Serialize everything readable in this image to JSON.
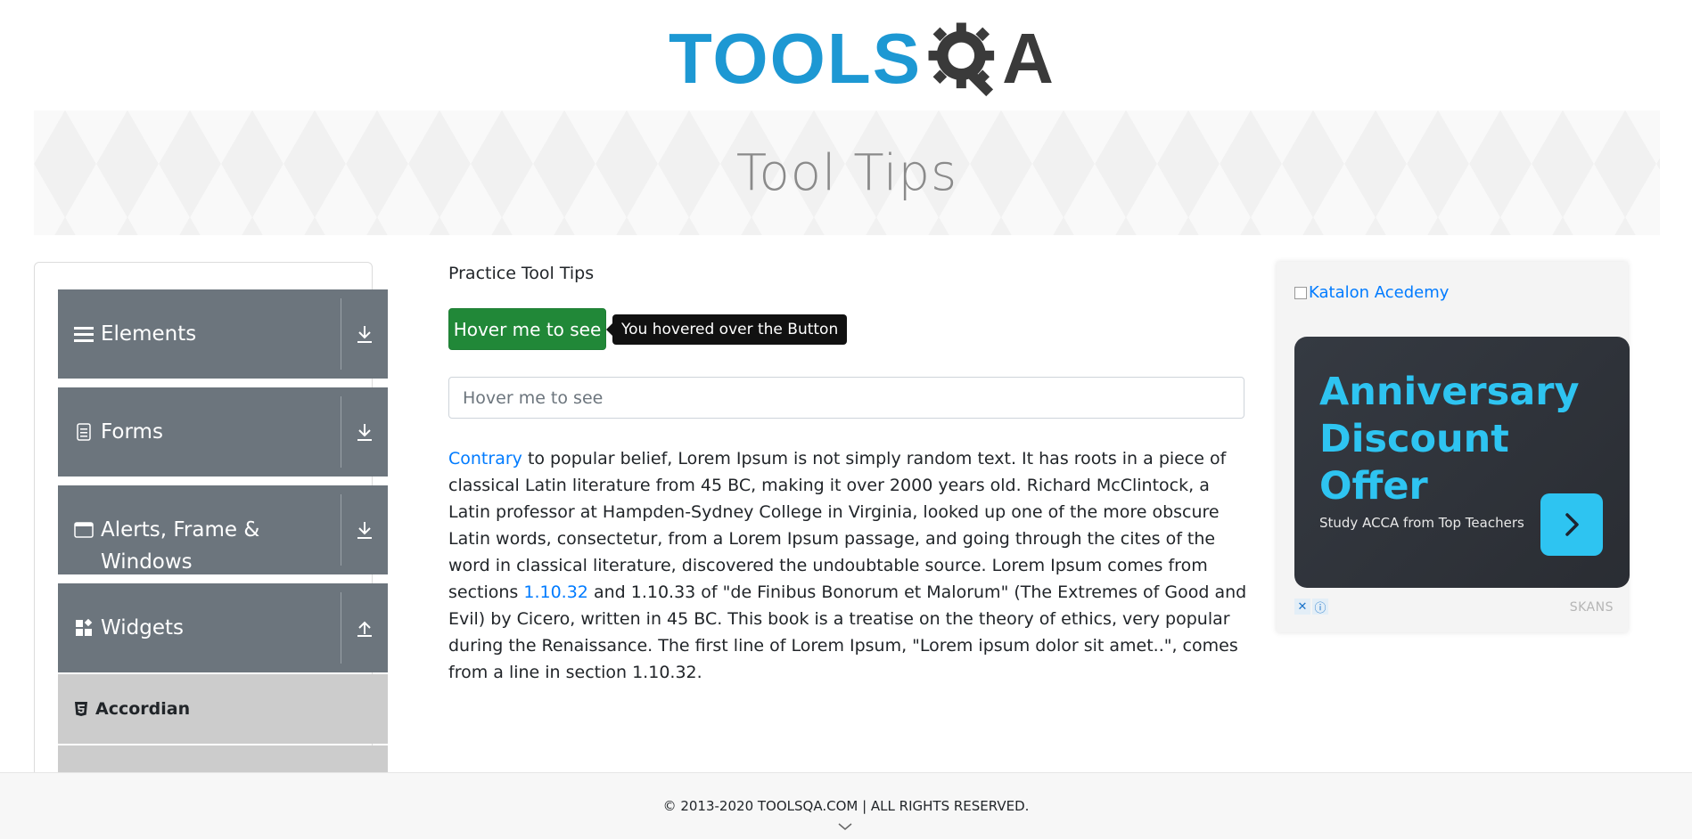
{
  "header": {
    "logo_left": "TOOLS",
    "logo_right": "A"
  },
  "banner": {
    "title": "Tool Tips"
  },
  "sidebar": {
    "groups": [
      {
        "label": "Elements",
        "icon": "hamburger-icon"
      },
      {
        "label": "Forms",
        "icon": "document-icon"
      },
      {
        "label": "Alerts, Frame & Windows",
        "icon": "window-icon"
      },
      {
        "label": "Widgets",
        "icon": "widgets-icon"
      }
    ],
    "active_item": "Accordian"
  },
  "main": {
    "section_title": "Practice Tool Tips",
    "hover_button_label": "Hover me to see",
    "tooltip_text": "You hovered over the Button",
    "hover_input_placeholder": "Hover me to see",
    "para_link1": "Contrary",
    "para_text1": " to popular belief, Lorem Ipsum is not simply random text. It has roots in a piece of classical Latin literature from 45 BC, making it over 2000 years old. Richard McClintock, a Latin professor at Hampden-Sydney College in Virginia, looked up one of the more obscure Latin words, consectetur, from a Lorem Ipsum passage, and going through the cites of the word in classical literature, discovered the undoubtable source. Lorem Ipsum comes from sections ",
    "para_link2": "1.10.32",
    "para_text2": " and 1.10.33 of \"de Finibus Bonorum et Malorum\" (The Extremes of Good and Evil) by Cicero, written in 45 BC. This book is a treatise on the theory of ethics, very popular during the Renaissance. The first line of Lorem Ipsum, \"Lorem ipsum dolor sit amet..\", comes from a line in section 1.10.32."
  },
  "ad": {
    "broken_image_alt": "Katalon Acedemy",
    "headline": "Anniversary Discount Offer",
    "subtext": "Study ACCA from Top Teachers",
    "brand": "SKANS",
    "accent_color": "#2ec4f1"
  },
  "footer": {
    "copyright": "© 2013-2020 TOOLSQA.COM | ALL RIGHTS RESERVED."
  },
  "colors": {
    "logo_blue": "#1d98d3",
    "sidebar_gray": "#6c757d",
    "button_green": "#28a745",
    "link_blue": "#007bff"
  }
}
